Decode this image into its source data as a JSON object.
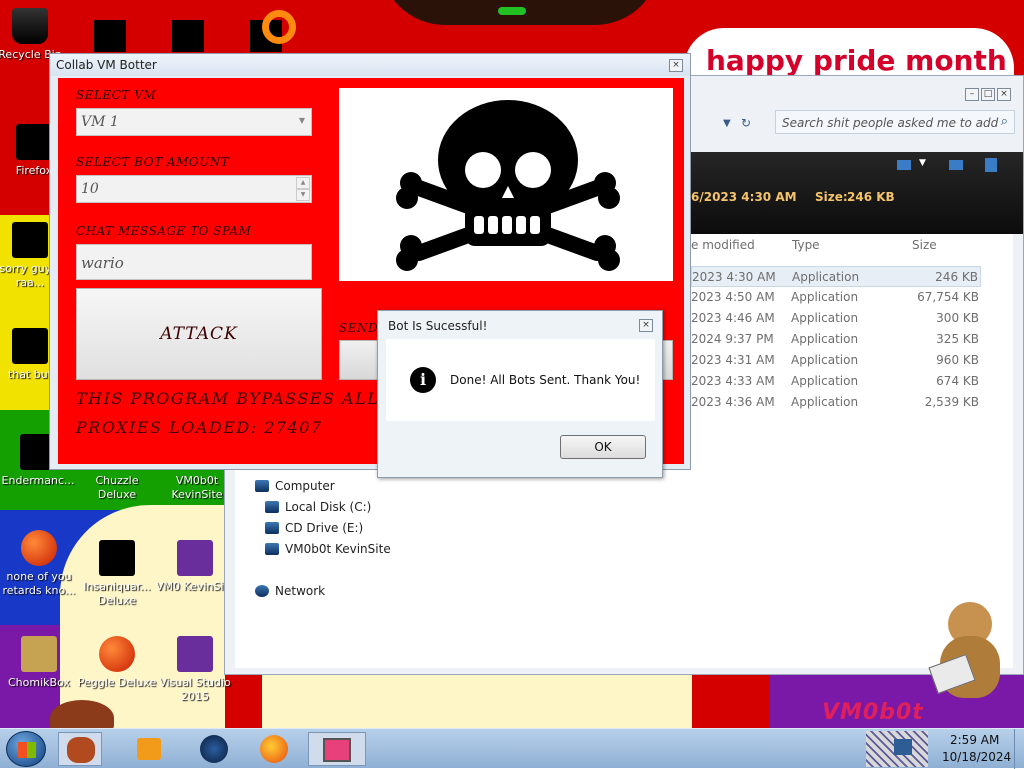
{
  "desktop": {
    "banner": "happy pride month",
    "watermark": "VM0b0t",
    "colors": {
      "red": "#d40000",
      "yellow": "#f2e200",
      "green": "#14a000",
      "blue": "#1838c8",
      "purple": "#7a18a8",
      "cream": "#fff6c8"
    },
    "icons": [
      {
        "label": "Recycle Bin"
      },
      {
        "label": "Firefox"
      },
      {
        "label": "sorry guys, raa..."
      },
      {
        "label": "that but"
      },
      {
        "label": "Endermanc..."
      },
      {
        "label": "Chuzzle Deluxe"
      },
      {
        "label": "VM0b0t KevinSite"
      },
      {
        "label": "none of you retards kno..."
      },
      {
        "label": "Insaniquar... Deluxe"
      },
      {
        "label": "VM0 KevinSi..."
      },
      {
        "label": "ChomikBox"
      },
      {
        "label": "Peggle Deluxe"
      },
      {
        "label": "Visual Studio 2015"
      }
    ]
  },
  "explorer": {
    "search_placeholder": "Search shit people asked me to add",
    "details": {
      "date_fragment": "6/2023 4:30 AM",
      "size_label": "Size:",
      "size_value": "246 KB"
    },
    "columns": [
      "e modified",
      "Type",
      "Size"
    ],
    "rows": [
      {
        "date": "2023 4:30 AM",
        "type": "Application",
        "size": "246 KB"
      },
      {
        "date": "2023 4:50 AM",
        "type": "Application",
        "size": "67,754 KB"
      },
      {
        "date": "2023 4:46 AM",
        "type": "Application",
        "size": "300 KB"
      },
      {
        "date": "2024 9:37 PM",
        "type": "Application",
        "size": "325 KB"
      },
      {
        "date": "2023 4:31 AM",
        "type": "Application",
        "size": "960 KB"
      },
      {
        "date": "2023 4:33 AM",
        "type": "Application",
        "size": "674 KB"
      },
      {
        "date": "2023 4:36 AM",
        "type": "Application",
        "size": "2,539 KB"
      }
    ],
    "nav": {
      "computer": "Computer",
      "local_disk": "Local Disk (C:)",
      "cd_drive": "CD Drive (E:)",
      "share": "VM0b0t KevinSite",
      "network": "Network"
    }
  },
  "bot": {
    "title": "Collab VM Botter",
    "select_vm_label": "SELECT VM",
    "vm_value": "VM 1",
    "bot_amount_label": "SELECT BOT AMOUNT",
    "bot_amount_value": "10",
    "chat_label": "CHAT MESSAGE TO SPAM",
    "chat_value": "wario",
    "attack_label": "ATTACK",
    "send_label": "SEND",
    "bypass_text": "THIS PROGRAM BYPASSES ALL WHI",
    "proxies_text": "PROXIES LOADED: 27407"
  },
  "dialog": {
    "title": "Bot Is Sucessful!",
    "message": "Done! All Bots Sent. Thank You!",
    "ok_label": "OK"
  },
  "taskbar": {
    "time": "2:59 AM",
    "date": "10/18/2024"
  }
}
